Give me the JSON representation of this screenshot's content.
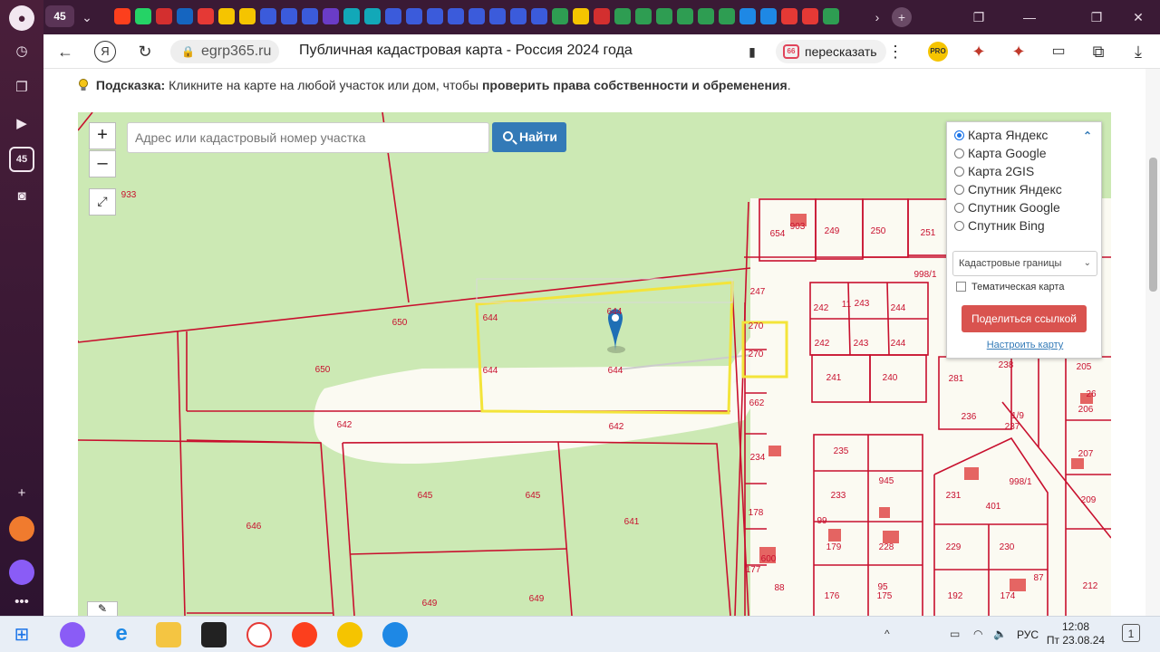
{
  "browser": {
    "tab_counter": "45",
    "url_host": "egrp365.ru",
    "page_title": "Публичная кадастровая карта - Россия 2024 года",
    "retell_label": "пересказать",
    "retell_icon_text": "66",
    "pro_badge": "PRO"
  },
  "rail": {
    "counter": "45"
  },
  "hint": {
    "label": "Подсказка:",
    "text": "Кликните на карте на любой участок или дом, чтобы",
    "bold_text": "проверить права собственности и обременения",
    "end": "."
  },
  "map": {
    "zoom_in": "+",
    "zoom_out": "–",
    "search_placeholder": "Адрес или кадастровый номер участка",
    "find_label": "Найти",
    "layers": [
      {
        "label": "Карта Яндекс",
        "checked": true
      },
      {
        "label": "Карта Google",
        "checked": false
      },
      {
        "label": "Карта 2GIS",
        "checked": false
      },
      {
        "label": "Спутник Яндекс",
        "checked": false
      },
      {
        "label": "Спутник Google",
        "checked": false
      },
      {
        "label": "Спутник Bing",
        "checked": false
      }
    ],
    "boundary_select": "Кадастровые границы",
    "thematic_label": "Тематическая карта",
    "share_label": "Поделиться ссылкой",
    "setup_link": "Настроить карту",
    "parcel_labels": [
      "933",
      "650",
      "650",
      "644",
      "644",
      "644",
      "644",
      "642",
      "642",
      "645",
      "645",
      "646",
      "641",
      "649",
      "649",
      "654",
      "903",
      "249",
      "250",
      "251",
      "998/1",
      "247",
      "242",
      "243",
      "244",
      "242",
      "243",
      "244",
      "11",
      "270",
      "270",
      "241",
      "240",
      "281",
      "238",
      "205",
      "662",
      "236",
      "237",
      "1/9",
      "206",
      "26",
      "235",
      "234",
      "945",
      "231",
      "998/1",
      "207",
      "233",
      "401",
      "209",
      "178",
      "99",
      "179",
      "228",
      "229",
      "230",
      "177",
      "600",
      "87",
      "88",
      "176",
      "95",
      "175",
      "192",
      "174",
      "212"
    ]
  },
  "taskbar": {
    "lang": "РУС",
    "time": "12:08",
    "date": "Пт 23.08.24",
    "notifications": "1"
  },
  "colors": {
    "map_bg": "#cce9b4",
    "road": "#fbfaf2",
    "parcel_border": "#c8102e",
    "selection": "#f3e43a",
    "marker": "#1f6fb5",
    "find_button": "#337ab7",
    "share_button": "#d9534f"
  }
}
